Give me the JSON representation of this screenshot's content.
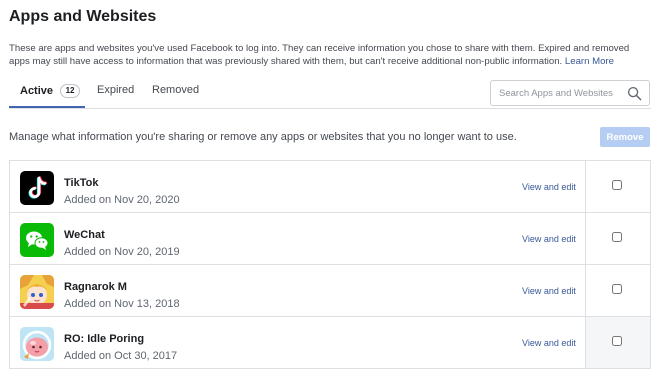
{
  "page": {
    "title": "Apps and Websites",
    "description": "These are apps and websites you've used Facebook to log into. They can receive information you chose to share with them. Expired and removed apps may still have access to information that was previously shared with them, but can't receive additional non-public information.",
    "learn_more": "Learn More"
  },
  "tabs": [
    {
      "label": "Active",
      "badge": "12",
      "active": true
    },
    {
      "label": "Expired",
      "active": false
    },
    {
      "label": "Removed",
      "active": false
    }
  ],
  "search": {
    "placeholder": "Search Apps and Websites",
    "value": "",
    "icon": "search-icon"
  },
  "manage_text": "Manage what information you're sharing or remove any apps or websites that you no longer want to use.",
  "remove_button": "Remove",
  "colors": {
    "accent": "#4267b2",
    "link": "#385898",
    "remove_disabled": "#b6cdf3"
  },
  "apps": [
    {
      "name": "TikTok",
      "added": "Added on Nov 20, 2020",
      "action": "View and edit",
      "icon": "tiktok-icon"
    },
    {
      "name": "WeChat",
      "added": "Added on Nov 20, 2019",
      "action": "View and edit",
      "icon": "wechat-icon"
    },
    {
      "name": "Ragnarok M",
      "added": "Added on Nov 13, 2018",
      "action": "View and edit",
      "icon": "ragnarok-m-icon"
    },
    {
      "name": "RO: Idle Poring",
      "added": "Added on Oct 30, 2017",
      "action": "View and edit",
      "icon": "ro-idle-poring-icon"
    }
  ]
}
